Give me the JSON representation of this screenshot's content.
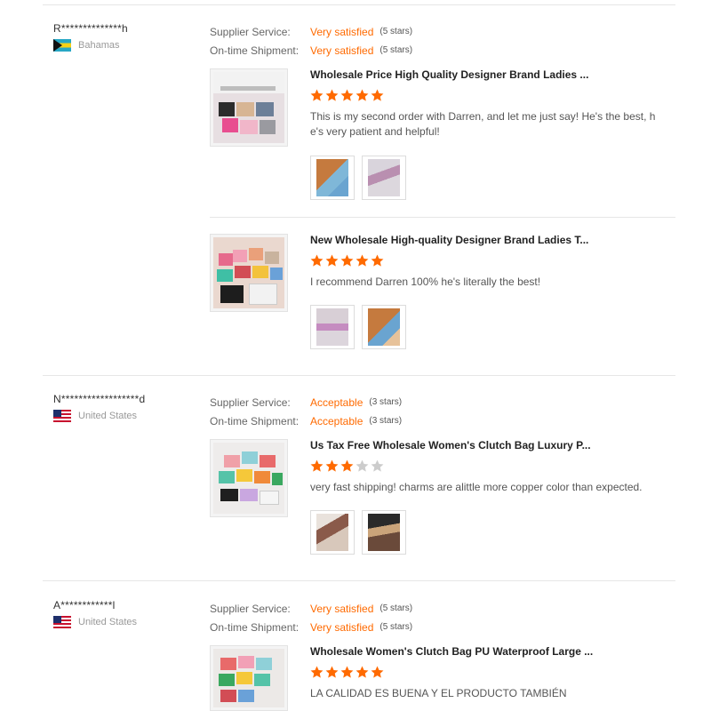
{
  "labels": {
    "supplier_service": "Supplier Service:",
    "ontime_shipment": "On-time Shipment:"
  },
  "colors": {
    "accent": "#ff6a00",
    "star_empty": "#cccccc"
  },
  "reviews": [
    {
      "user": "R**************h",
      "country": "Bahamas",
      "flag": "bahamas-flag-icon",
      "supplier_service": {
        "value": "Very satisfied",
        "stars_text": "(5 stars)"
      },
      "ontime_shipment": {
        "value": "Very satisfied",
        "stars_text": "(5 stars)"
      },
      "items": [
        {
          "title": "Wholesale Price High Quality Designer Brand Ladies ...",
          "rating": 5,
          "comment": "This is my second order with Darren, and let me just say! He's the best, h e's very patient and helpful!",
          "photo_count": 2
        },
        {
          "title": "New Wholesale High-quality Designer Brand Ladies T...",
          "rating": 5,
          "comment": "I recommend Darren 100% he's literally the best!",
          "photo_count": 2
        }
      ]
    },
    {
      "user": "N******************d",
      "country": "United States",
      "flag": "usa-flag-icon",
      "supplier_service": {
        "value": "Acceptable",
        "stars_text": "(3 stars)"
      },
      "ontime_shipment": {
        "value": "Acceptable",
        "stars_text": "(3 stars)"
      },
      "items": [
        {
          "title": "Us Tax Free Wholesale Women's Clutch Bag Luxury P...",
          "rating": 3,
          "comment": "very fast shipping! charms are alittle more copper color than expected.",
          "photo_count": 2
        }
      ]
    },
    {
      "user": "A************l",
      "country": "United States",
      "flag": "usa-flag-icon",
      "supplier_service": {
        "value": "Very satisfied",
        "stars_text": "(5 stars)"
      },
      "ontime_shipment": {
        "value": "Very satisfied",
        "stars_text": "(5 stars)"
      },
      "items": [
        {
          "title": "Wholesale Women's Clutch Bag PU Waterproof Large ...",
          "rating": 5,
          "comment": "LA CALIDAD ES BUENA Y EL PRODUCTO TAMBIÉN",
          "photo_count": 0
        }
      ]
    }
  ]
}
